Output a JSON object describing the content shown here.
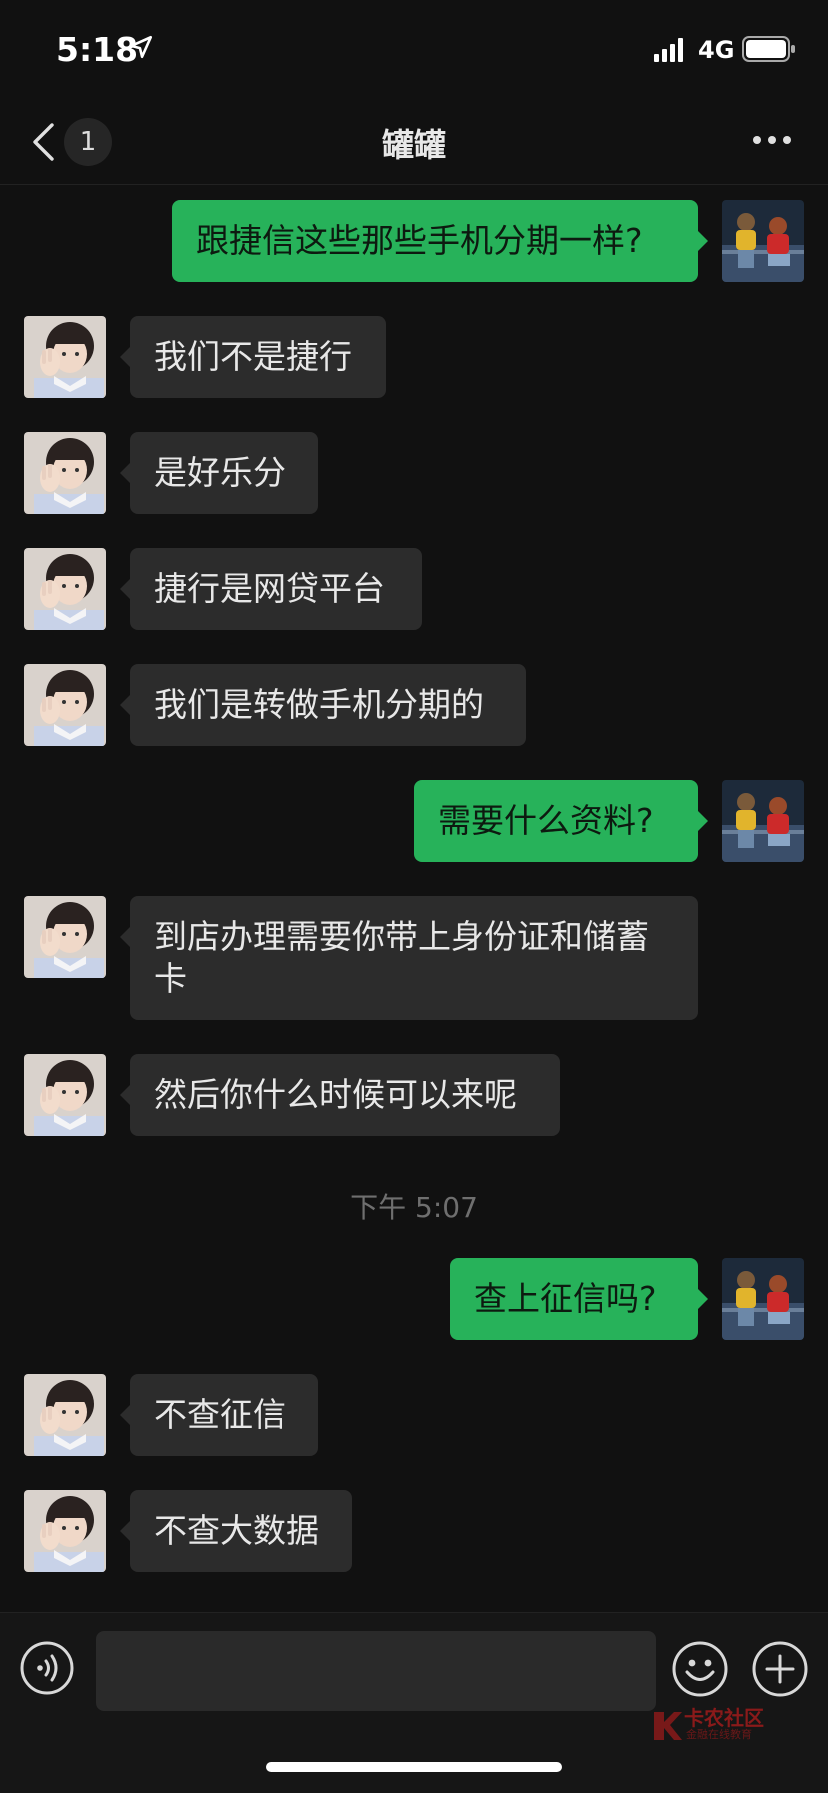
{
  "status": {
    "time": "5:18",
    "network": "4G"
  },
  "nav": {
    "badge": "1",
    "title": "罐罐"
  },
  "messages": [
    {
      "dir": "out",
      "text": "跟捷信这些那些手机分期一样?"
    },
    {
      "dir": "in",
      "text": "我们不是捷行"
    },
    {
      "dir": "in",
      "text": "是好乐分"
    },
    {
      "dir": "in",
      "text": "捷行是网贷平台"
    },
    {
      "dir": "in",
      "text": "我们是转做手机分期的"
    },
    {
      "dir": "out",
      "text": "需要什么资料?"
    },
    {
      "dir": "in",
      "text": "到店办理需要你带上身份证和储蓄\n卡"
    },
    {
      "dir": "in",
      "text": "然后你什么时候可以来呢"
    },
    {
      "dir": "out",
      "text": "查上征信吗?"
    },
    {
      "dir": "in",
      "text": "不查征信"
    },
    {
      "dir": "in",
      "text": "不查大数据"
    }
  ],
  "timestamp": "下午 5:07",
  "watermark": {
    "title": "卡农社区",
    "subtitle": "金融在线教育"
  },
  "colors": {
    "background": "#111111",
    "bubble_in": "#2c2c2c",
    "bubble_out": "#27b25a"
  },
  "icons": [
    "location-arrow-icon",
    "signal-icon",
    "battery-icon",
    "back-chevron-icon",
    "more-dots-icon",
    "voice-icon",
    "emoji-icon",
    "plus-icon"
  ]
}
